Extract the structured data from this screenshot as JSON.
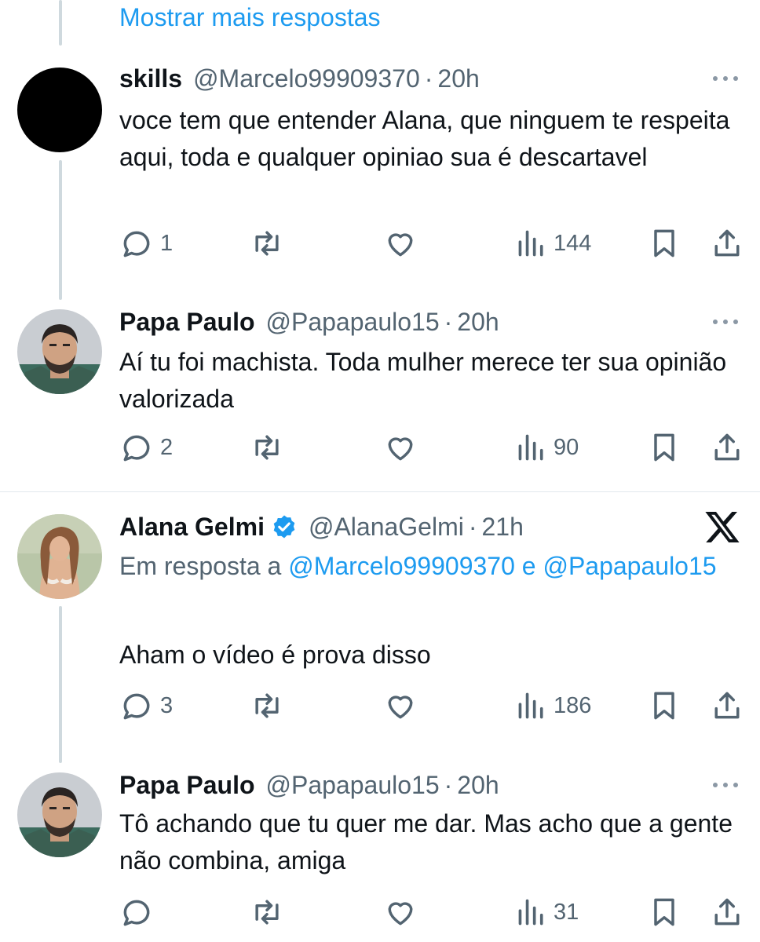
{
  "thread": {
    "show_more_label": "Mostrar mais respostas"
  },
  "tweets": [
    {
      "name": "skills",
      "handle": "@Marcelo99909370",
      "separator": "·",
      "time": "20h",
      "text": "voce tem que entender Alana, que ninguem te respeita aqui, toda e qualquer opiniao sua é descartavel",
      "replies": "1",
      "retweets": "",
      "likes": "",
      "views": "144"
    },
    {
      "name": "Papa Paulo",
      "handle": "@Papapaulo15",
      "separator": "·",
      "time": "20h",
      "text": "Aí tu foi machista. Toda mulher merece ter sua opinião valorizada",
      "replies": "2",
      "retweets": "",
      "likes": "",
      "views": "90"
    },
    {
      "name": "Alana Gelmi",
      "handle": "@AlanaGelmi",
      "separator": "·",
      "time": "21h",
      "verified": true,
      "reply_prefix": "Em resposta a",
      "reply_mention_1": "@Marcelo99909370",
      "reply_conjunction": "e",
      "reply_mention_2": "@Papapaulo15",
      "text": "Aham o vídeo é prova disso",
      "replies": "3",
      "retweets": "",
      "likes": "",
      "views": "186"
    },
    {
      "name": "Papa Paulo",
      "handle": "@Papapaulo15",
      "separator": "·",
      "time": "20h",
      "text": "Tô achando que tu quer me dar. Mas acho que a gente não combina, amiga",
      "replies": "",
      "retweets": "",
      "likes": "",
      "views": "31"
    }
  ],
  "colors": {
    "accent": "#1d9bf0",
    "text": "#0f1419",
    "secondary": "#536471",
    "thread_line": "#cfd9de",
    "verified": "#1d9bf0"
  },
  "icons": {
    "more": "more-dots-icon",
    "reply": "reply-icon",
    "retweet": "retweet-icon",
    "like": "heart-icon",
    "views": "views-icon",
    "bookmark": "bookmark-icon",
    "share": "share-icon",
    "x_logo": "x-logo-icon",
    "verified": "verified-badge-icon"
  }
}
